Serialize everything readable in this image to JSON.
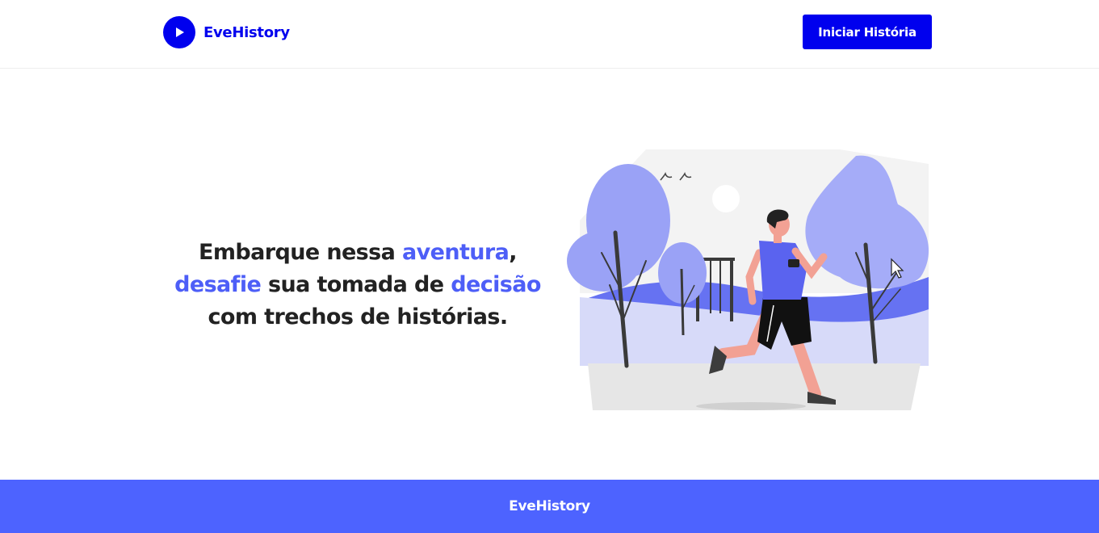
{
  "brand": {
    "name": "EveHistory",
    "icon": "play-icon",
    "color": "#0000ee"
  },
  "header": {
    "cta_label": "Iniciar História"
  },
  "hero": {
    "line1_a": "Embarque nessa ",
    "line1_hl": "aventura",
    "line1_b": ",",
    "line2_hl1": "desafie",
    "line2_mid": " sua tomada de ",
    "line2_hl2": "decisão",
    "line3": "com trechos de histórias.",
    "highlight_color": "#4d5ef7",
    "illustration": "runner-in-park-illustration"
  },
  "footer": {
    "text": "EveHistory",
    "background": "#4d63ff"
  }
}
